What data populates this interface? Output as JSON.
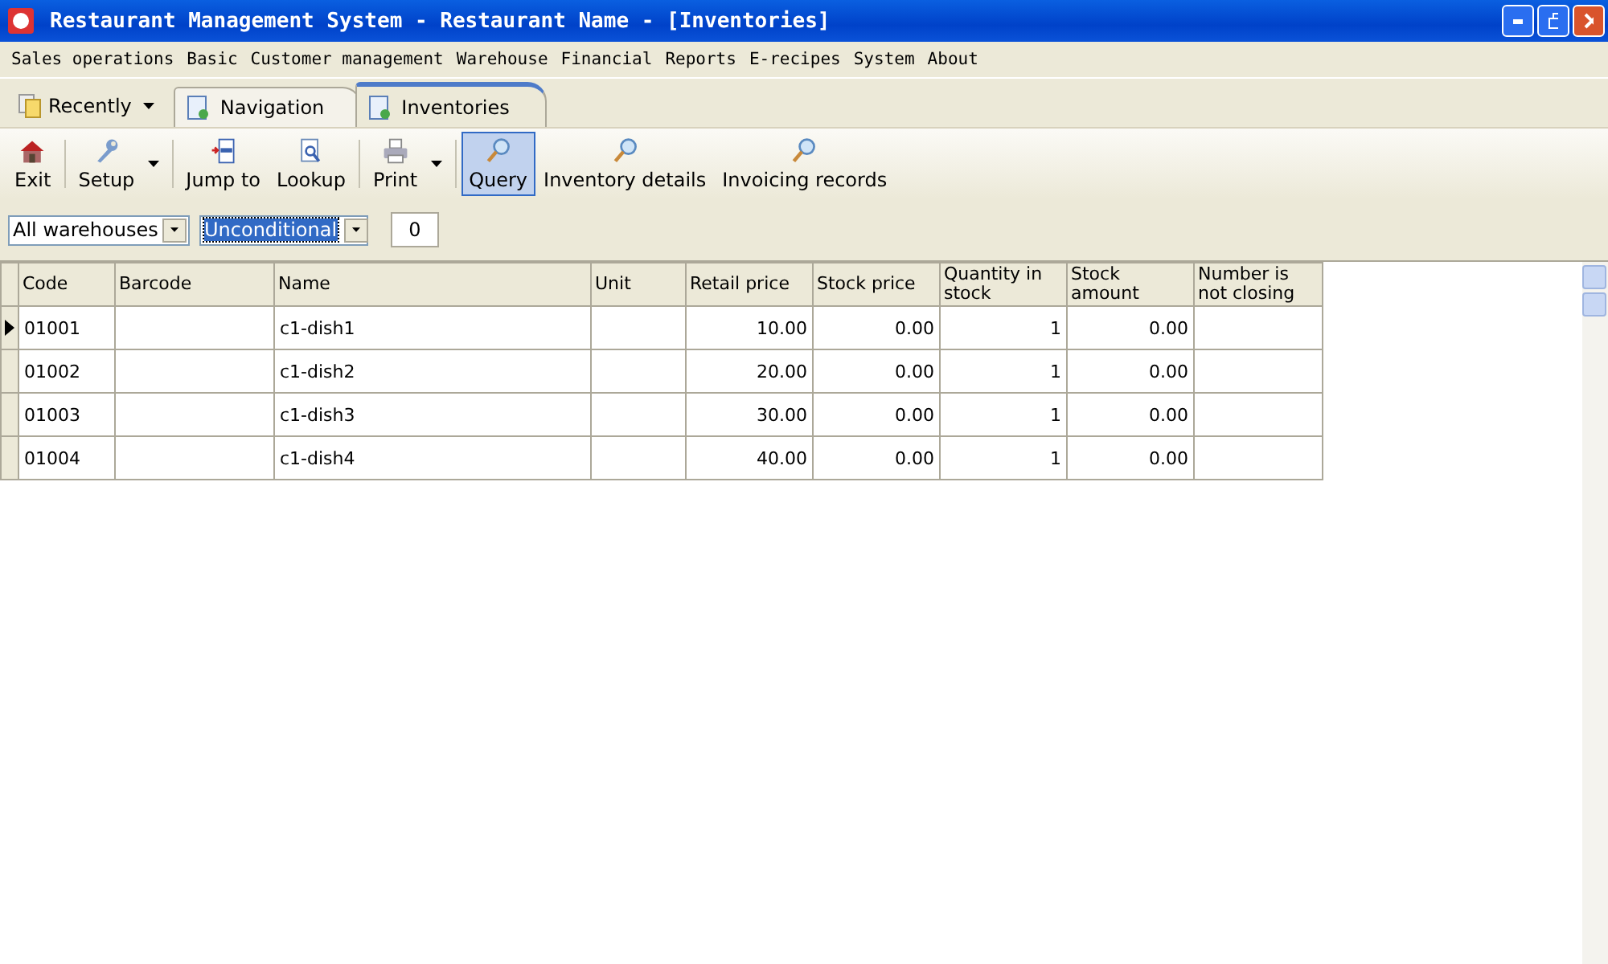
{
  "window": {
    "title": "Restaurant Management System - Restaurant Name - [Inventories]"
  },
  "menu": [
    "Sales operations",
    "Basic",
    "Customer management",
    "Warehouse",
    "Financial",
    "Reports",
    "E-recipes",
    "System",
    "About"
  ],
  "recent": {
    "label": "Recently"
  },
  "tabs": [
    {
      "label": "Navigation",
      "selected": false
    },
    {
      "label": "Inventories",
      "selected": true
    }
  ],
  "toolbar": [
    [
      {
        "label": "Exit",
        "kind": "house",
        "dropdown": false,
        "selected": false
      }
    ],
    [
      {
        "label": "Setup",
        "kind": "wrench",
        "dropdown": true,
        "selected": false
      }
    ],
    [
      {
        "label": "Jump to",
        "kind": "jump",
        "dropdown": false,
        "selected": false
      },
      {
        "label": "Lookup",
        "kind": "lookup",
        "dropdown": false,
        "selected": false
      }
    ],
    [
      {
        "label": "Print",
        "kind": "printer",
        "dropdown": true,
        "selected": false
      }
    ],
    [
      {
        "label": "Query",
        "kind": "magnifier",
        "dropdown": false,
        "selected": true
      },
      {
        "label": "Inventory details",
        "kind": "magnifier",
        "dropdown": false,
        "selected": false
      },
      {
        "label": "Invoicing records",
        "kind": "magnifier",
        "dropdown": false,
        "selected": false
      }
    ]
  ],
  "filters": {
    "warehouse": "All warehouses",
    "condition": "Unconditional",
    "count": "0"
  },
  "table": {
    "columns": [
      "Code",
      "Barcode",
      "Name",
      "Unit",
      "Retail price",
      "Stock price",
      "Quantity in stock",
      "Stock amount",
      "Number is not closing"
    ],
    "rows": [
      {
        "current": true,
        "cells": [
          "01001",
          "",
          "c1-dish1",
          "",
          "10.00",
          "0.00",
          "1",
          "0.00",
          ""
        ]
      },
      {
        "current": false,
        "cells": [
          "01002",
          "",
          "c1-dish2",
          "",
          "20.00",
          "0.00",
          "1",
          "0.00",
          ""
        ]
      },
      {
        "current": false,
        "cells": [
          "01003",
          "",
          "c1-dish3",
          "",
          "30.00",
          "0.00",
          "1",
          "0.00",
          ""
        ]
      },
      {
        "current": false,
        "cells": [
          "01004",
          "",
          "c1-dish4",
          "",
          "40.00",
          "0.00",
          "1",
          "0.00",
          ""
        ]
      }
    ]
  }
}
